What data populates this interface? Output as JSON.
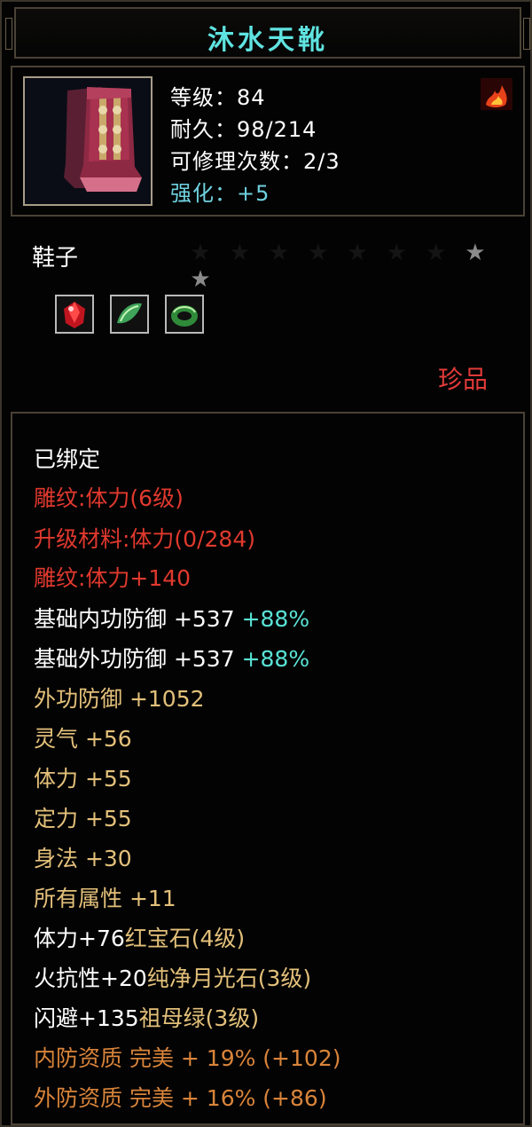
{
  "item": {
    "name": "沐水天靴",
    "stats": {
      "level": "等级：84",
      "durability": "耐久：98/214",
      "repair": "可修理次数：2/3",
      "enhance": "强化：+5"
    },
    "type": "鞋子",
    "stars_total": 9,
    "stars_lit": 2,
    "gems": [
      "ruby",
      "jade-leaf",
      "emerald-ring"
    ],
    "rarity": "珍品"
  },
  "attributes": {
    "bound": "已绑定",
    "engrave1": "雕纹:体力(6级)",
    "upgrade": "升级材料:体力(0/284)",
    "engrave2": "雕纹:体力+140",
    "base_inner": "基础内功防御 +537",
    "base_inner_pct": "+88%",
    "base_outer": "基础外功防御 +537",
    "base_outer_pct": "+88%",
    "outer_def": "外功防御 +1052",
    "lingqi": "灵气 +56",
    "tili": "体力 +55",
    "dingli": "定力 +55",
    "shenfa": "身法 +30",
    "all_attr": "所有属性 +11",
    "gem1_stat": "体力+76",
    "gem1_name": "红宝石(4级)",
    "gem2_stat": "火抗性+20",
    "gem2_name": "纯净月光石(3级)",
    "gem3_stat": "闪避+135",
    "gem3_name": "祖母绿(3级)",
    "inner_quality": "内防资质 完美 + 19% (+102)",
    "outer_quality": "外防资质 完美 + 16% (+86)"
  }
}
